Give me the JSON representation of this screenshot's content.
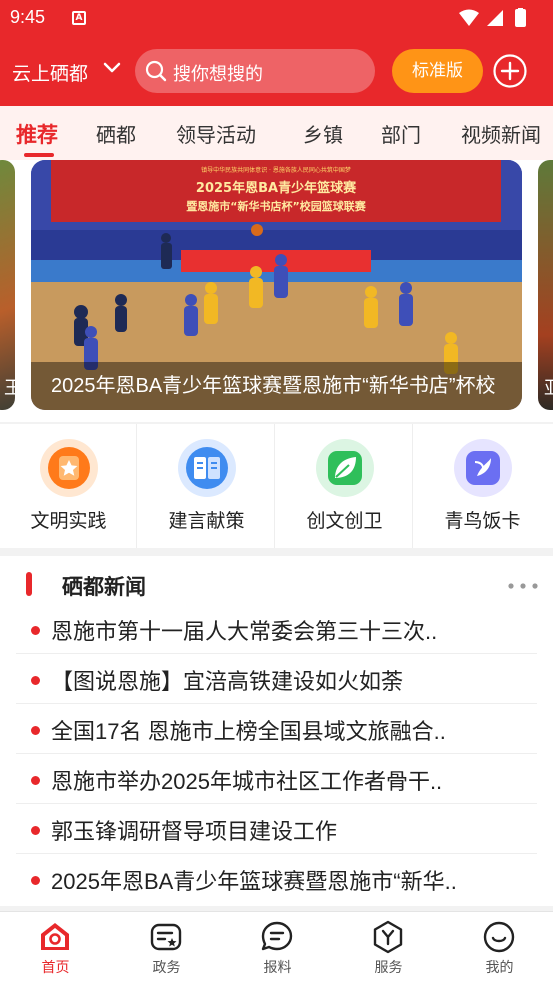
{
  "status_bar": {
    "time": "9:45",
    "notification": "A"
  },
  "header": {
    "city": "云上硒都",
    "search_placeholder": "搜你想搜的",
    "edition_button": "标准版",
    "colors": {
      "primary": "#e8282b",
      "edition": "#ff9416"
    }
  },
  "tabs": [
    {
      "label": "推荐",
      "active": true
    },
    {
      "label": "硒都",
      "active": false
    },
    {
      "label": "领导活动",
      "active": false
    },
    {
      "label": "乡镇",
      "active": false
    },
    {
      "label": "部门",
      "active": false
    },
    {
      "label": "视频新闻",
      "active": false
    }
  ],
  "banner": {
    "caption": "2025年恩BA青少年篮球赛暨恩施市“新华书店”杯校",
    "left_peek_text": "王",
    "right_peek_text": "亚",
    "photo_texts": {
      "line1": "镇导中华民族共同体意识 · 恩施各族人民同心共筑中国梦",
      "line2": "2025年恩BA青少年篮球赛",
      "line3": "暨恩施市“新华书店杯”校园篮球联赛"
    }
  },
  "shortcuts": [
    {
      "label": "文明实践",
      "icon": "star-badge-icon",
      "color": "#ff7a1a"
    },
    {
      "label": "建言献策",
      "icon": "book-icon",
      "color": "#3f8cf0"
    },
    {
      "label": "创文创卫",
      "icon": "leaf-icon",
      "color": "#2fbf5a"
    },
    {
      "label": "青鸟饭卡",
      "icon": "bird-card-icon",
      "color": "#6b6ff2"
    }
  ],
  "news": {
    "title": "硒都新闻",
    "items": [
      "恩施市第十一届人大常委会第三十三次..",
      "【图说恩施】宜涪高铁建设如火如荼",
      "全国17名 恩施市上榜全国县域文旅融合..",
      "恩施市举办2025年城市社区工作者骨干..",
      "郭玉锋调研督导项目建设工作",
      "2025年恩BA青少年篮球赛暨恩施市“新华.."
    ]
  },
  "bottom_nav": [
    {
      "label": "首页",
      "icon": "home-icon",
      "active": true
    },
    {
      "label": "政务",
      "icon": "government-icon",
      "active": false
    },
    {
      "label": "报料",
      "icon": "report-chat-icon",
      "active": false
    },
    {
      "label": "服务",
      "icon": "service-icon",
      "active": false
    },
    {
      "label": "我的",
      "icon": "profile-icon",
      "active": false
    }
  ]
}
